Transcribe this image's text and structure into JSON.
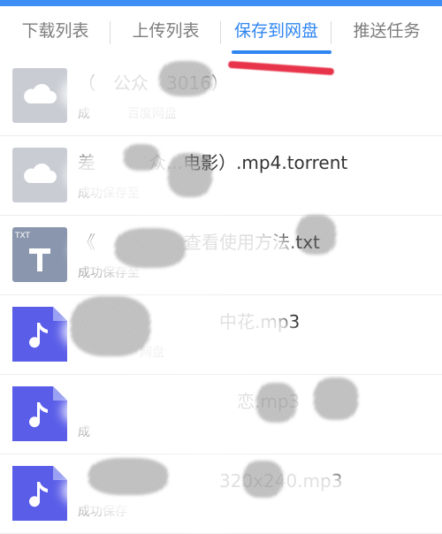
{
  "tabs": [
    {
      "label": "下载列表"
    },
    {
      "label": "上传列表"
    },
    {
      "label": "保存到网盘"
    },
    {
      "label": "推送任务"
    }
  ],
  "active_tab": "保存到网盘",
  "colors": {
    "accent": "#2f86f0",
    "cloud_icon": "#c9cdd3",
    "txt_icon": "#8a96ad",
    "audio_icon": "#5a5de8"
  },
  "items": [
    {
      "icon": "cloud-icon",
      "title": "（　公众　3016）",
      "status": "成　　　百度网盘"
    },
    {
      "icon": "cloud-icon",
      "title": "差　　　众...电影）.mp4.torrent",
      "status": "成功保存至"
    },
    {
      "icon": "txt-icon",
      "icon_tag": "TXT",
      "title": "《　　　　　查看使用方法.txt",
      "status": "成功保存至"
    },
    {
      "icon": "music-icon",
      "title": "　　　　　　　　中花.mp3",
      "status": "　　　　　网盘"
    },
    {
      "icon": "music-icon",
      "title": "　　　　　　　　　恋.mp3",
      "status": "成"
    },
    {
      "icon": "music-icon",
      "title": "　　　　　　　　320x240.mp3",
      "status": "成功保存"
    }
  ]
}
